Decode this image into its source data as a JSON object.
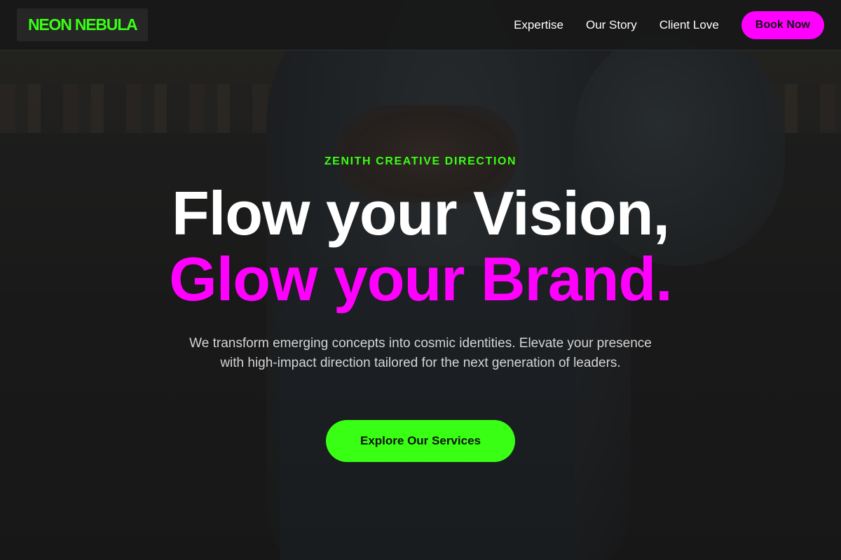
{
  "header": {
    "logo": "NEON NEBULA",
    "nav": [
      {
        "label": "Expertise"
      },
      {
        "label": "Our Story"
      },
      {
        "label": "Client Love"
      }
    ],
    "cta_label": "Book Now"
  },
  "hero": {
    "eyebrow": "ZENITH CREATIVE DIRECTION",
    "headline_line1": "Flow your Vision,",
    "headline_line2": "Glow your Brand.",
    "subtitle": "We transform emerging concepts into cosmic identities. Elevate your presence with high-impact direction tailored for the next generation of leaders.",
    "cta_label": "Explore Our Services"
  },
  "colors": {
    "neon_green": "#39ff14",
    "neon_magenta": "#ff00ff",
    "header_bg": "#181818"
  }
}
